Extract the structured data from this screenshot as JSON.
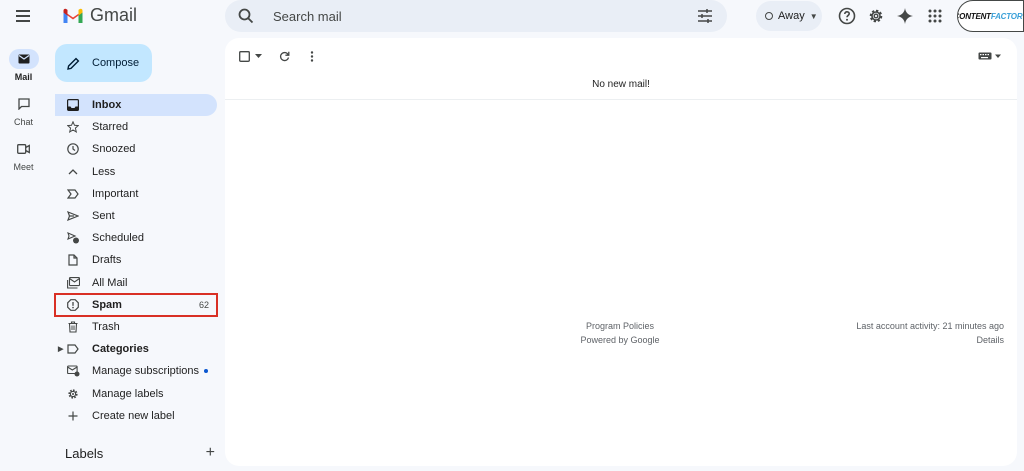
{
  "app": {
    "name": "Gmail"
  },
  "search": {
    "placeholder": "Search mail"
  },
  "status": {
    "label": "Away"
  },
  "brand_badge": {
    "part1": "CONTENT",
    "part2": "FACTORY"
  },
  "rail": [
    {
      "label": "Mail"
    },
    {
      "label": "Chat"
    },
    {
      "label": "Meet"
    }
  ],
  "compose": {
    "label": "Compose"
  },
  "nav": {
    "inbox": "Inbox",
    "starred": "Starred",
    "snoozed": "Snoozed",
    "less": "Less",
    "important": "Important",
    "sent": "Sent",
    "scheduled": "Scheduled",
    "drafts": "Drafts",
    "all_mail": "All Mail",
    "spam": "Spam",
    "spam_count": "62",
    "trash": "Trash",
    "categories": "Categories",
    "manage_subscriptions": "Manage subscriptions",
    "manage_labels": "Manage labels",
    "create_label": "Create new label"
  },
  "labels_section": {
    "title": "Labels",
    "add": "+"
  },
  "main": {
    "empty_message": "No new mail!",
    "footer": {
      "program_policies": "Program Policies",
      "powered_by": "Powered by Google",
      "last_activity": "Last account activity: 21 minutes ago",
      "details": "Details"
    }
  },
  "colors": {
    "background": "#f6f8fc",
    "compose": "#c2e7ff",
    "active_nav": "#d3e3fd",
    "highlight_box": "#d93025",
    "accent": "#0b57d0"
  }
}
